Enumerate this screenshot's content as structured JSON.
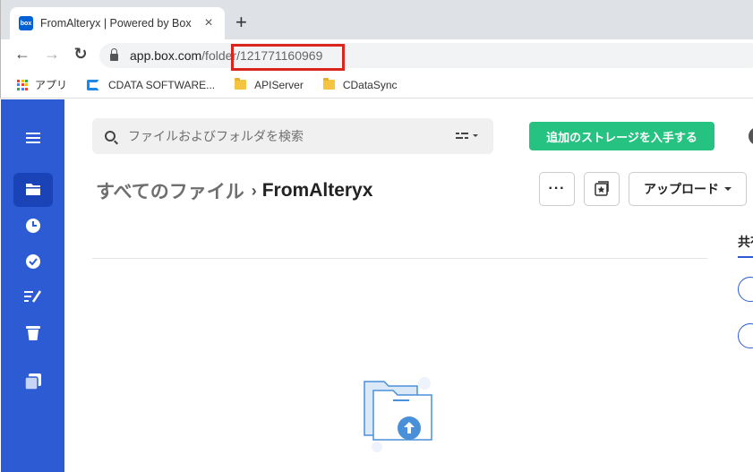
{
  "browser": {
    "tab": {
      "favicon_text": "box",
      "title": "FromAlteryx | Powered by Box",
      "close": "×"
    },
    "new_tab": "+",
    "nav": {
      "back": "←",
      "forward": "→",
      "reload": "↻"
    },
    "url": {
      "host": "app.box.com",
      "path": "/folder/121771160969"
    },
    "highlight_color": "#d9251c",
    "bookmarks": [
      {
        "label": "アプリ",
        "icon": "apps-grid-icon"
      },
      {
        "label": "CDATA SOFTWARE...",
        "icon": "cdata-logo-icon"
      },
      {
        "label": "APIServer",
        "icon": "folder-icon"
      },
      {
        "label": "CDataSync",
        "icon": "folder-icon"
      }
    ]
  },
  "sidebar": {
    "color": "#2d5bd3",
    "items": [
      {
        "icon": "menu-icon"
      },
      {
        "icon": "files-icon",
        "active": true
      },
      {
        "icon": "recents-icon"
      },
      {
        "icon": "tasks-icon"
      },
      {
        "icon": "notes-icon"
      },
      {
        "icon": "trash-icon"
      },
      {
        "icon": "relay-icon"
      }
    ]
  },
  "header": {
    "search_placeholder": "ファイルおよびフォルダを検索",
    "storage_button": "追加のストレージを入手する",
    "storage_button_color": "#26c281"
  },
  "breadcrumb": {
    "root": "すべてのファイル",
    "separator": "›",
    "current": "FromAlteryx"
  },
  "actions": {
    "more": "···",
    "upload": "アップロード"
  },
  "side_panel": {
    "label": "共有"
  }
}
